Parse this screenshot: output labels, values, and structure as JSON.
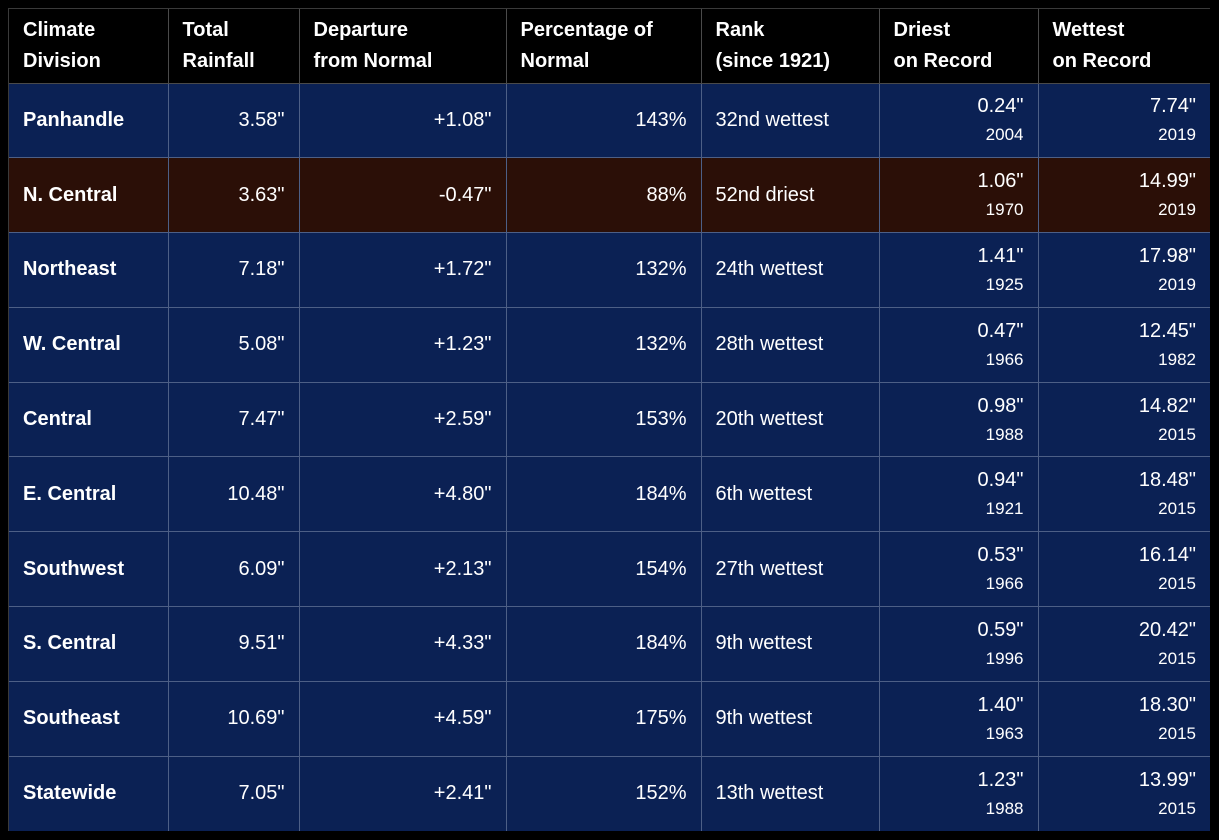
{
  "chart_data": {
    "type": "table",
    "columns": [
      [
        "Climate",
        "Division"
      ],
      [
        "Total",
        "Rainfall"
      ],
      [
        "Departure",
        "from Normal"
      ],
      [
        "Percentage of",
        "Normal"
      ],
      [
        "Rank",
        "(since 1921)"
      ],
      [
        "Driest",
        "on Record"
      ],
      [
        "Wettest",
        "on Record"
      ]
    ],
    "rows": [
      {
        "division": "Panhandle",
        "total": "3.58\"",
        "departure": "+1.08\"",
        "percent": "143%",
        "rank": "32nd wettest",
        "driest": "0.24\"",
        "driest_year": "2004",
        "wettest": "7.74\"",
        "wettest_year": "2019",
        "highlight": false
      },
      {
        "division": "N. Central",
        "total": "3.63\"",
        "departure": "-0.47\"",
        "percent": "88%",
        "rank": "52nd driest",
        "driest": "1.06\"",
        "driest_year": "1970",
        "wettest": "14.99\"",
        "wettest_year": "2019",
        "highlight": true
      },
      {
        "division": "Northeast",
        "total": "7.18\"",
        "departure": "+1.72\"",
        "percent": "132%",
        "rank": "24th wettest",
        "driest": "1.41\"",
        "driest_year": "1925",
        "wettest": "17.98\"",
        "wettest_year": "2019",
        "highlight": false
      },
      {
        "division": "W. Central",
        "total": "5.08\"",
        "departure": "+1.23\"",
        "percent": "132%",
        "rank": "28th wettest",
        "driest": "0.47\"",
        "driest_year": "1966",
        "wettest": "12.45\"",
        "wettest_year": "1982",
        "highlight": false
      },
      {
        "division": "Central",
        "total": "7.47\"",
        "departure": "+2.59\"",
        "percent": "153%",
        "rank": "20th wettest",
        "driest": "0.98\"",
        "driest_year": "1988",
        "wettest": "14.82\"",
        "wettest_year": "2015",
        "highlight": false
      },
      {
        "division": "E. Central",
        "total": "10.48\"",
        "departure": "+4.80\"",
        "percent": "184%",
        "rank": "6th wettest",
        "driest": "0.94\"",
        "driest_year": "1921",
        "wettest": "18.48\"",
        "wettest_year": "2015",
        "highlight": false
      },
      {
        "division": "Southwest",
        "total": "6.09\"",
        "departure": "+2.13\"",
        "percent": "154%",
        "rank": "27th wettest",
        "driest": "0.53\"",
        "driest_year": "1966",
        "wettest": "16.14\"",
        "wettest_year": "2015",
        "highlight": false
      },
      {
        "division": "S. Central",
        "total": "9.51\"",
        "departure": "+4.33\"",
        "percent": "184%",
        "rank": "9th wettest",
        "driest": "0.59\"",
        "driest_year": "1996",
        "wettest": "20.42\"",
        "wettest_year": "2015",
        "highlight": false
      },
      {
        "division": "Southeast",
        "total": "10.69\"",
        "departure": "+4.59\"",
        "percent": "175%",
        "rank": "9th wettest",
        "driest": "1.40\"",
        "driest_year": "1963",
        "wettest": "18.30\"",
        "wettest_year": "2015",
        "highlight": false
      },
      {
        "division": "Statewide",
        "total": "7.05\"",
        "departure": "+2.41\"",
        "percent": "152%",
        "rank": "13th wettest",
        "driest": "1.23\"",
        "driest_year": "1988",
        "wettest": "13.99\"",
        "wettest_year": "2015",
        "highlight": false
      }
    ]
  },
  "colors": {
    "header_bg": "#000000",
    "row_bg": "#0b2154",
    "highlight_bg": "#2b0f07",
    "text": "#ffffff"
  }
}
